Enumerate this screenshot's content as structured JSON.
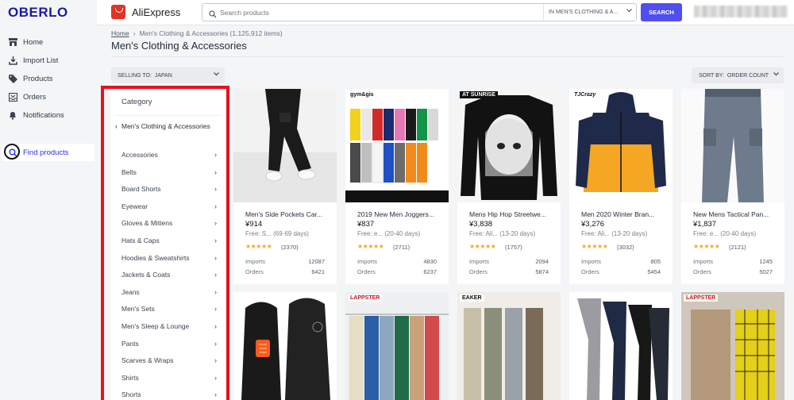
{
  "brand": "OBERLO",
  "nav": [
    {
      "label": "Home",
      "icon": "home-icon"
    },
    {
      "label": "Import List",
      "icon": "import-icon"
    },
    {
      "label": "Products",
      "icon": "tag-icon"
    },
    {
      "label": "Orders",
      "icon": "orders-icon"
    },
    {
      "label": "Notifications",
      "icon": "bell-icon"
    },
    {
      "label": "Find products",
      "icon": "search-icon"
    }
  ],
  "header": {
    "app_name": "AliExpress",
    "search_placeholder": "Search products",
    "search_scope": "IN MEN'S CLOTHING & A...",
    "search_button": "SEARCH"
  },
  "breadcrumb": {
    "home": "Home",
    "current": "Men's Clothing & Accessories (1,125,912 items)"
  },
  "page_title": "Men's Clothing & Accessories",
  "selling_to": "SELLING TO:  JAPAN",
  "sort_by": "SORT BY:  ORDER COUNT",
  "category": {
    "title": "Category",
    "parent": "Men's Clothing & Accessories",
    "items": [
      "Accessories",
      "Belts",
      "Board Shorts",
      "Eyewear",
      "Gloves & Mittens",
      "Hats & Caps",
      "Hoodies & Sweatshirts",
      "Jackets & Coats",
      "Jeans",
      "Men's Sets",
      "Men's Sleep & Lounge",
      "Pants",
      "Scarves & Wraps",
      "Shirts",
      "Shorts"
    ]
  },
  "products": [
    {
      "title": "Men's Side Pockets Car...",
      "price": "¥914",
      "shipping": "Free: S...  (69-69 days)",
      "stars": "★★★★★",
      "reviews": "(2370)",
      "imports_label": "Imports",
      "imports": "12087",
      "orders_label": "Orders",
      "orders": "6421"
    },
    {
      "title": "2019 New Men Joggers...",
      "price": "¥837",
      "shipping": "Free: e...  (20-40 days)",
      "stars": "★★★★★",
      "reviews": "(2711)",
      "imports_label": "Imports",
      "imports": "4830",
      "orders_label": "Orders",
      "orders": "6237"
    },
    {
      "title": "Mens Hip Hop Streetwe...",
      "price": "¥3,838",
      "shipping": "Free: Ali...  (13-20 days)",
      "stars": "★★★★★",
      "reviews": "(1757)",
      "imports_label": "Imports",
      "imports": "2094",
      "orders_label": "Orders",
      "orders": "5874"
    },
    {
      "title": "Men 2020 Winter Bran...",
      "price": "¥3,276",
      "shipping": "Free: Ali...  (13-20 days)",
      "stars": "★★★★★",
      "reviews": "(3032)",
      "imports_label": "Imports",
      "imports": "805",
      "orders_label": "Orders",
      "orders": "5454"
    },
    {
      "title": "New Mens Tactical Pan...",
      "price": "¥1,837",
      "shipping": "Free: e...  (20-40 days)",
      "stars": "★★★★★",
      "reviews": "(2121)",
      "imports_label": "Imports",
      "imports": "1245",
      "orders_label": "Orders",
      "orders": "5027"
    }
  ],
  "image_tags": {
    "p2": "gym&gis",
    "p3": "AT SUNRISE",
    "p4": "TJCrazy",
    "p7": "LAPPSTER",
    "p8": "EAKER",
    "p10": "LAPPSTER"
  },
  "colors": {
    "accent": "#4f4ff0",
    "brand": "#1a1aa6",
    "highlight": "#e8101d",
    "stars": "#f5a623"
  }
}
